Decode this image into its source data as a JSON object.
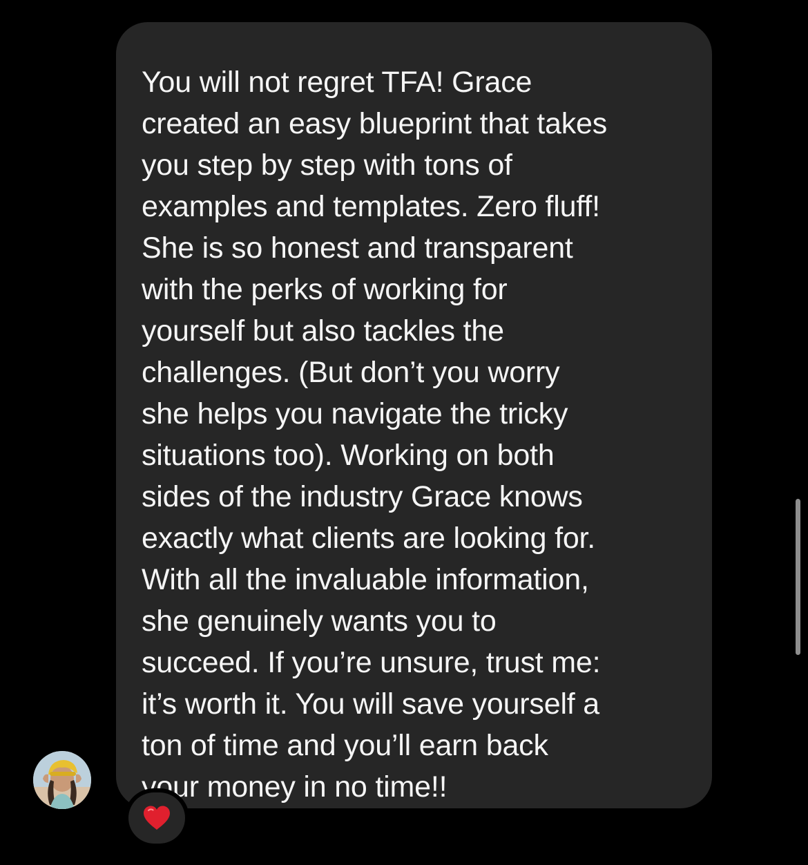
{
  "message": {
    "text": "You will not regret TFA! Grace\ncreated an easy blueprint that takes\nyou step by step with tons of\nexamples and templates. Zero fluff!\nShe is so honest and transparent\nwith the perks of working for\nyourself but also tackles the\nchallenges. (But don’t you worry\nshe helps you navigate the tricky\nsituations too). Working on both\nsides of the industry Grace knows\nexactly what clients are looking for.\nWith all the invaluable information,\nshe genuinely wants you to\nsucceed. If you’re unsure, trust me:\nit’s worth it. You will save yourself a\nton of time and you’ll earn back\nyour money in no time!!"
  },
  "reaction": {
    "icon": "red-heart-icon",
    "color": "#e0202e"
  },
  "sender": {
    "avatar_icon": "profile-photo-avatar"
  },
  "colors": {
    "background": "#000000",
    "bubble": "#262626",
    "text": "#f5f5f5"
  }
}
